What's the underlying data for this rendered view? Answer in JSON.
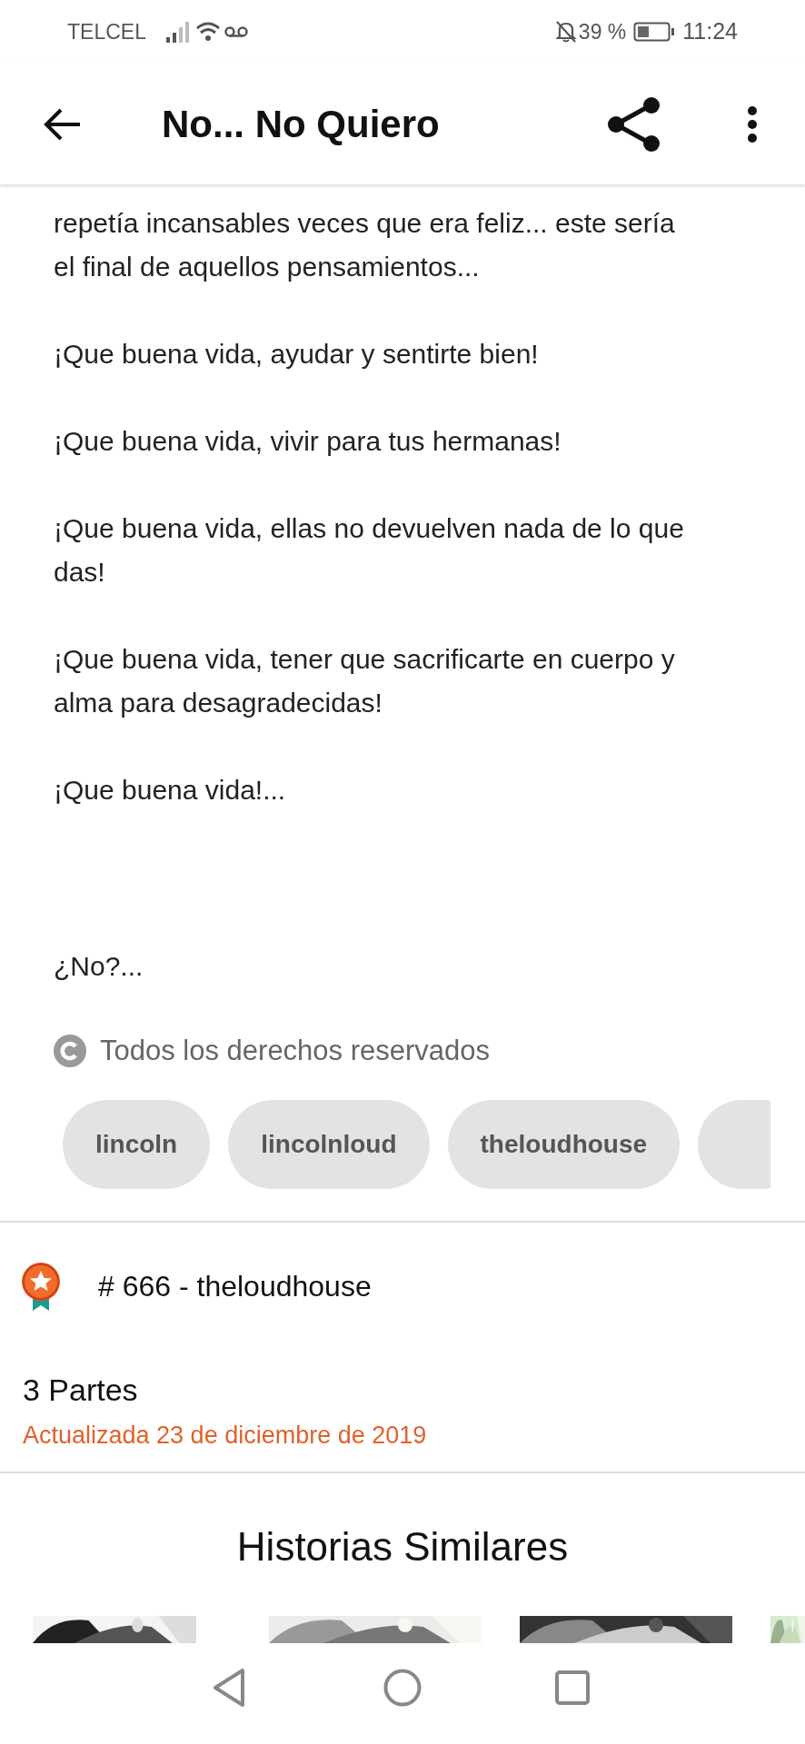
{
  "status_bar": {
    "carrier": "TELCEL",
    "battery": "39 %",
    "time": "11:24"
  },
  "header": {
    "title": "No... No Quiero"
  },
  "story": {
    "paragraphs": [
      "repetía incansables veces que era feliz... este sería\nel final de aquellos pensamientos...",
      "¡Que buena vida, ayudar y sentirte bien!",
      "¡Que buena vida, vivir para tus hermanas!",
      "¡Que buena vida, ellas no devuelven nada de lo que\ndas!",
      "¡Que buena vida, tener que sacrificarte en cuerpo y\nalma para desagradecidas!",
      "¡Que buena vida!..."
    ],
    "closing": "¿No?...",
    "copyright": "Todos los derechos reservados",
    "tags": [
      "lincoln",
      "lincolnloud",
      "theloudhouse"
    ]
  },
  "ranking": {
    "text": "# 666 - theloudhouse"
  },
  "parts": {
    "count": "3 Partes",
    "updated": "Actualizada 23 de diciembre de 2019"
  },
  "similar": {
    "title": "Historias Similares"
  }
}
